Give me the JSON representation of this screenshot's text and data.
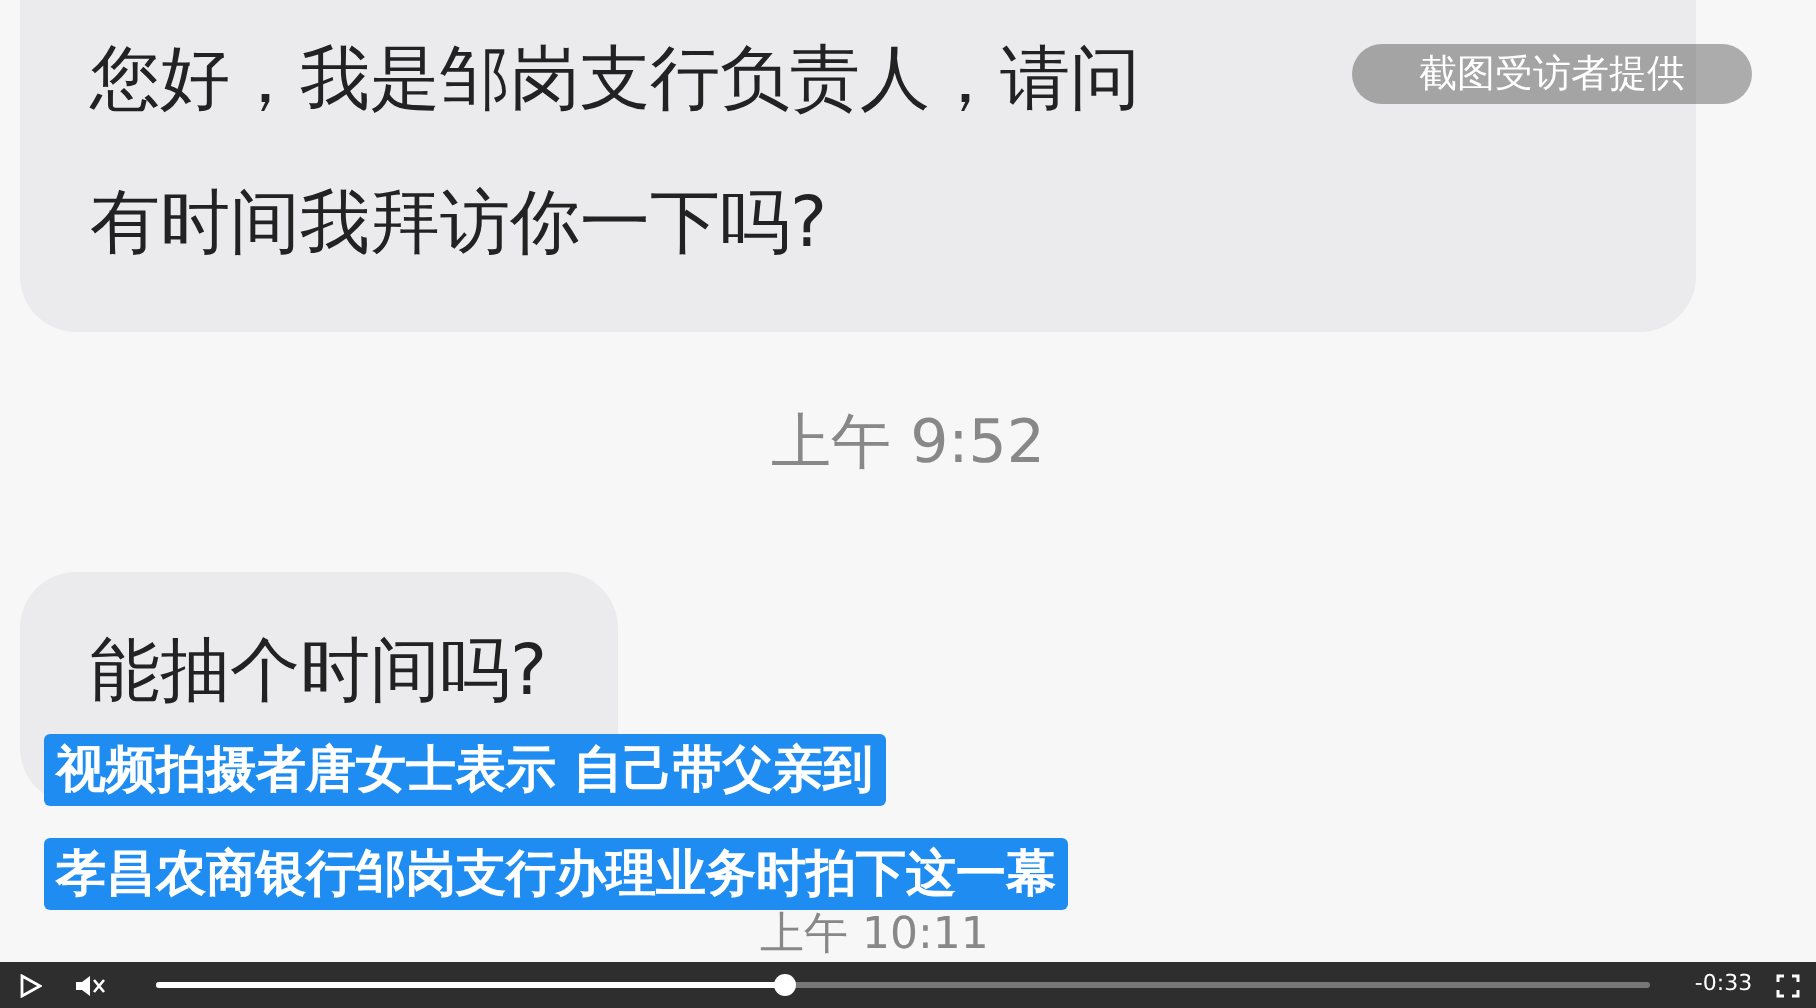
{
  "video": {
    "badge": "截图受访者提供",
    "messages": [
      {
        "kind": "bubble",
        "lines": [
          "您好，我是邹岗支行负责人，请问",
          "有时间我拜访你一下吗?"
        ]
      },
      {
        "kind": "time",
        "text": "上午 9:52"
      },
      {
        "kind": "bubble",
        "lines": [
          "能抽个时间吗?"
        ]
      },
      {
        "kind": "time",
        "text": "上午 10:11"
      }
    ],
    "subtitles": [
      "视频拍摄者唐女士表示 自己带父亲到",
      "孝昌农商银行邹岗支行办理业务时拍下这一幕"
    ]
  },
  "controls": {
    "playing": false,
    "muted": true,
    "progress": {
      "level": 0.42
    },
    "time": "-0:33"
  }
}
